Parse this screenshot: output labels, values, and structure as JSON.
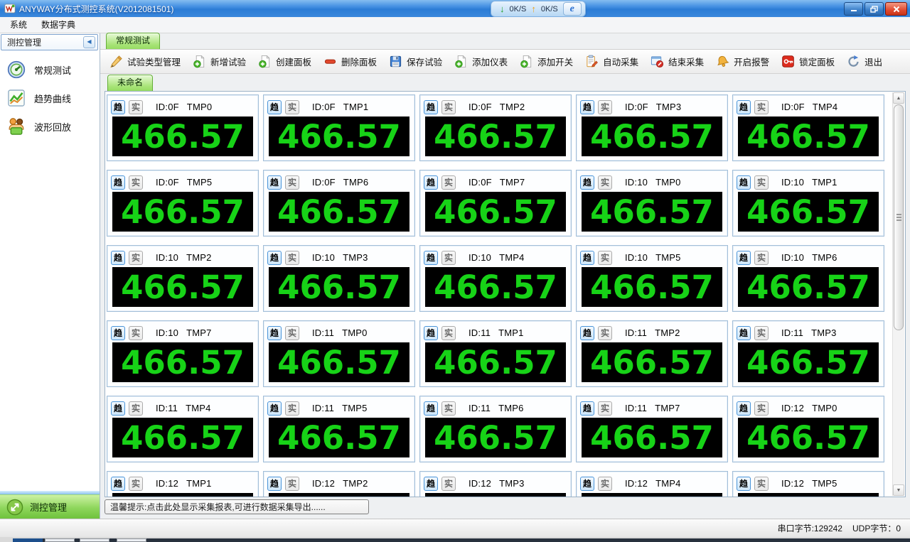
{
  "window": {
    "title": "ANYWAY分布式测控系统(V2012081501)",
    "net": {
      "down": "0K/S",
      "up": "0K/S"
    }
  },
  "menu": {
    "items": [
      "系统",
      "数据字典"
    ]
  },
  "sidebar": {
    "header": "测控管理",
    "items": [
      {
        "label": "常规测试",
        "icon": "gauge-icon"
      },
      {
        "label": "趋势曲线",
        "icon": "trend-chart-icon"
      },
      {
        "label": "波形回放",
        "icon": "waveform-playback-icon"
      }
    ],
    "bottom": {
      "label": "测控管理",
      "icon": "resize-arrows-icon"
    }
  },
  "main": {
    "tab": "常规测试",
    "panel_tab": "未命名",
    "toolbar": [
      {
        "label": "试验类型管理",
        "icon": "pencil-icon"
      },
      {
        "label": "新增试验",
        "icon": "add-page-icon"
      },
      {
        "label": "创建面板",
        "icon": "add-page-icon"
      },
      {
        "label": "删除面板",
        "icon": "remove-icon"
      },
      {
        "label": "保存试验",
        "icon": "save-icon"
      },
      {
        "label": "添加仪表",
        "icon": "add-page-icon"
      },
      {
        "label": "添加开关",
        "icon": "add-page-icon"
      },
      {
        "label": "自动采集",
        "icon": "auto-collect-icon"
      },
      {
        "label": "结束采集",
        "icon": "stop-collect-icon"
      },
      {
        "label": "开启报警",
        "icon": "alarm-bell-icon"
      },
      {
        "label": "锁定面板",
        "icon": "lock-icon"
      },
      {
        "label": "退出",
        "icon": "exit-icon"
      }
    ],
    "meters": {
      "trend_button": "趋",
      "realtime_button": "实",
      "value": "466.57",
      "value_color": "#17d317",
      "items": [
        {
          "id": "ID:0F",
          "ch": "TMP0"
        },
        {
          "id": "ID:0F",
          "ch": "TMP1"
        },
        {
          "id": "ID:0F",
          "ch": "TMP2"
        },
        {
          "id": "ID:0F",
          "ch": "TMP3"
        },
        {
          "id": "ID:0F",
          "ch": "TMP4"
        },
        {
          "id": "ID:0F",
          "ch": "TMP5"
        },
        {
          "id": "ID:0F",
          "ch": "TMP6"
        },
        {
          "id": "ID:0F",
          "ch": "TMP7"
        },
        {
          "id": "ID:10",
          "ch": "TMP0"
        },
        {
          "id": "ID:10",
          "ch": "TMP1"
        },
        {
          "id": "ID:10",
          "ch": "TMP2"
        },
        {
          "id": "ID:10",
          "ch": "TMP3"
        },
        {
          "id": "ID:10",
          "ch": "TMP4"
        },
        {
          "id": "ID:10",
          "ch": "TMP5"
        },
        {
          "id": "ID:10",
          "ch": "TMP6"
        },
        {
          "id": "ID:10",
          "ch": "TMP7"
        },
        {
          "id": "ID:11",
          "ch": "TMP0"
        },
        {
          "id": "ID:11",
          "ch": "TMP1"
        },
        {
          "id": "ID:11",
          "ch": "TMP2"
        },
        {
          "id": "ID:11",
          "ch": "TMP3"
        },
        {
          "id": "ID:11",
          "ch": "TMP4"
        },
        {
          "id": "ID:11",
          "ch": "TMP5"
        },
        {
          "id": "ID:11",
          "ch": "TMP6"
        },
        {
          "id": "ID:11",
          "ch": "TMP7"
        },
        {
          "id": "ID:12",
          "ch": "TMP0"
        },
        {
          "id": "ID:12",
          "ch": "TMP1"
        },
        {
          "id": "ID:12",
          "ch": "TMP2"
        },
        {
          "id": "ID:12",
          "ch": "TMP3"
        },
        {
          "id": "ID:12",
          "ch": "TMP4"
        },
        {
          "id": "ID:12",
          "ch": "TMP5"
        }
      ]
    }
  },
  "footer": {
    "tip": "温馨提示:点击此处显示采集报表,可进行数据采集导出......",
    "status_serial": "串口字节:129242",
    "status_udp": "UDP字节：0"
  }
}
